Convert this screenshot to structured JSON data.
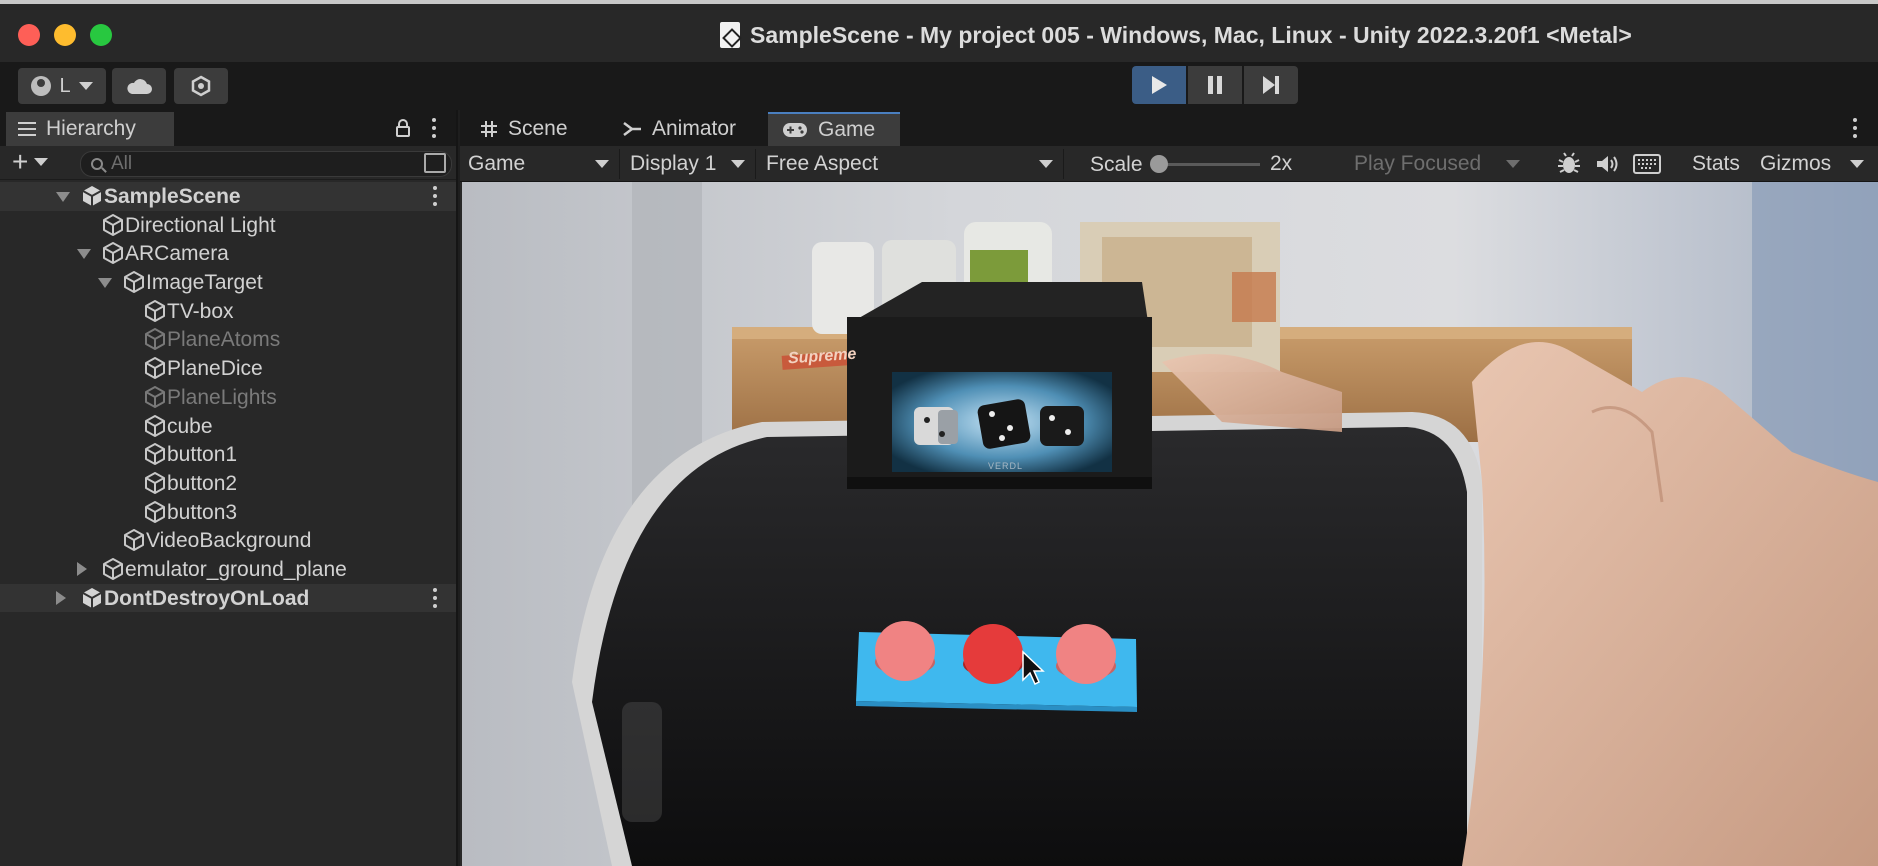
{
  "window": {
    "title": "SampleScene - My project 005 - Windows, Mac, Linux - Unity 2022.3.20f1 <Metal>"
  },
  "toolbar": {
    "account_label": "L",
    "play_state": "playing"
  },
  "hierarchy": {
    "tab_label": "Hierarchy",
    "search_placeholder": "All",
    "items": [
      {
        "label": "SampleScene",
        "type": "scene",
        "expanded": true
      },
      {
        "label": "Directional Light"
      },
      {
        "label": "ARCamera",
        "expanded": true
      },
      {
        "label": "ImageTarget",
        "expanded": true
      },
      {
        "label": "TV-box"
      },
      {
        "label": "PlaneAtoms",
        "inactive": true
      },
      {
        "label": "PlaneDice"
      },
      {
        "label": "PlaneLights",
        "inactive": true
      },
      {
        "label": "cube"
      },
      {
        "label": "button1"
      },
      {
        "label": "button2"
      },
      {
        "label": "button3"
      },
      {
        "label": "VideoBackground"
      },
      {
        "label": "emulator_ground_plane",
        "expanded": false
      },
      {
        "label": "DontDestroyOnLoad",
        "type": "scene",
        "expanded": false
      }
    ]
  },
  "game": {
    "tabs": [
      {
        "label": "Scene",
        "icon": "grid-icon"
      },
      {
        "label": "Animator",
        "icon": "animator-icon"
      },
      {
        "label": "Game",
        "icon": "gamepad-icon",
        "active": true
      }
    ],
    "options": {
      "view_mode": "Game",
      "display": "Display 1",
      "aspect": "Free Aspect",
      "scale_label": "Scale",
      "scale_value": "2x",
      "play_mode": "Play Focused",
      "stats_label": "Stats",
      "gizmos_label": "Gizmos"
    },
    "scene": {
      "tv_brand": "VERDL",
      "box_text": "Supreme"
    }
  },
  "colors": {
    "accent": "#3b5d86",
    "button_pink": "#f08383",
    "button_red": "#e53b3b",
    "panel_blue": "#3fb8ee"
  }
}
